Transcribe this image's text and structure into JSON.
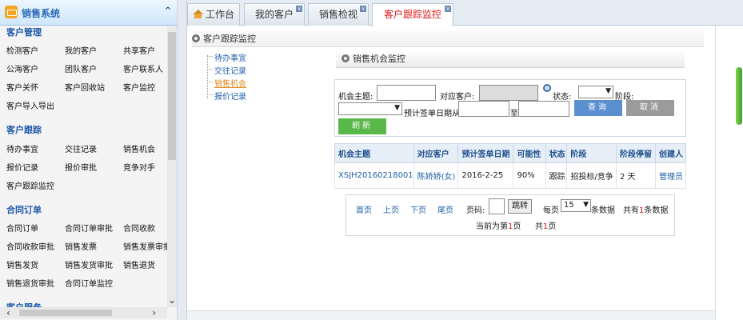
{
  "sidebar": {
    "title": "销售系统",
    "sections": [
      {
        "title": "客户管理",
        "items": [
          "检测客户",
          "我的客户",
          "共享客户",
          "公海客户",
          "团队客户",
          "客户联系人",
          "客户关怀",
          "客户回收站",
          "客户监控",
          "客户导入导出"
        ]
      },
      {
        "title": "客户跟踪",
        "items": [
          "待办事宜",
          "交往记录",
          "销售机会",
          "报价记录",
          "报价审批",
          "竞争对手",
          "客户跟踪监控"
        ]
      },
      {
        "title": "合同订单",
        "items": [
          "合同订单",
          "合同订单审批",
          "合同收款",
          "合同收款审批",
          "销售发票",
          "销售发票审批",
          "销售发货",
          "销售发货审批",
          "销售退货",
          "销售退货审批",
          "合同订单监控"
        ]
      },
      {
        "title": "客户服务",
        "items": []
      }
    ]
  },
  "tabs": [
    {
      "label": "工作台"
    },
    {
      "label": "我的客户"
    },
    {
      "label": "销售检视"
    },
    {
      "label": "客户跟踪监控"
    }
  ],
  "breadcrumb": "客户跟踪监控",
  "tree": [
    "待办事宜",
    "交往记录",
    "销售机会",
    "报价记录"
  ],
  "panel_title": "销售机会监控",
  "search": {
    "topic_label": "机会主题:",
    "customer_label": "对应客户:",
    "status_label": "状态:",
    "stage_label": "阶段:",
    "date_label": "预计签单日期从",
    "to_label": "至",
    "query_btn": "查询",
    "cancel_btn": "取消",
    "refresh_btn": "刷新",
    "colors": {
      "query": "#5b8fd0",
      "cancel": "#9b9b9b",
      "refresh": "#5ab84b"
    }
  },
  "table": {
    "headers": [
      "机会主题",
      "对应客户",
      "预计签单日期",
      "可能性",
      "状态",
      "阶段",
      "阶段停留",
      "创建人"
    ],
    "rows": [
      [
        "XSJH20160218001",
        "陈娇娇(女)",
        "2016-2-25",
        "90%",
        "跟踪",
        "招投标/竞争",
        "2 天",
        "管理员"
      ]
    ]
  },
  "pager": {
    "first": "首页",
    "prev": "上页",
    "next": "下页",
    "last": "尾页",
    "page_label": "页码:",
    "jump_btn": "跳转",
    "per_page_label": "每页",
    "per_page_value": "15",
    "per_page_unit": "条数据",
    "total_prefix": "共有",
    "total_count": "1",
    "total_suffix": "条数据",
    "current_prefix": "当前为第",
    "current_page": "1",
    "current_suffix": "页",
    "pages_prefix": "共",
    "pages_count": "1",
    "pages_suffix": "页"
  }
}
